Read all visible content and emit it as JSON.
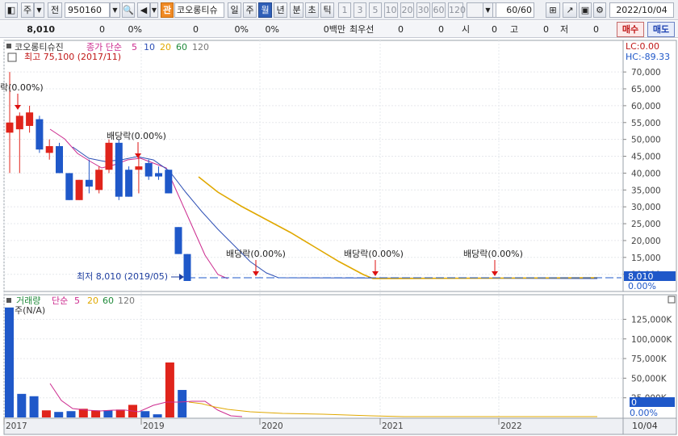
{
  "toolbar": {
    "market_label": "주",
    "prev_label": "전",
    "code": "950160",
    "tag_label": "관",
    "stock_name": "코오롱티슈",
    "period_tabs": [
      "일",
      "주",
      "월",
      "년",
      "분",
      "초",
      "틱"
    ],
    "active_period": "월",
    "interval_buttons": [
      "1",
      "3",
      "5",
      "10",
      "20",
      "30",
      "60",
      "120"
    ],
    "count_value": "60",
    "count_total": "/60",
    "date": "2022/10/04"
  },
  "info_row": {
    "price": "8,010",
    "change": "0",
    "change_pct": "0%",
    "v1": "0",
    "v1_pct": "0%",
    "v2_pct": "0%",
    "amount": "0백만",
    "best_bid_label": "최우선",
    "best_bid_a": "0",
    "best_bid_b": "0",
    "open_label": "시",
    "open_value": "0",
    "high_label": "고",
    "high_value": "0",
    "low_label": "저",
    "low_value": "0",
    "buy_label": "매수",
    "sell_label": "매도"
  },
  "price_panel": {
    "stock_name": "코오롱티슈진",
    "ma_label": "종가 단순",
    "ma_periods": [
      "5",
      "10",
      "20",
      "60",
      "120"
    ],
    "ma_colors": [
      "#cc2a8e",
      "#2d4fb5",
      "#e0a800",
      "#1f8a3a",
      "#777777"
    ],
    "high_note": "최고 75,100 (2017/11)",
    "low_note": "최저 8,010 (2019/05)",
    "lc_label": "LC:0.00",
    "hc_label": "HC:-89.33",
    "current_price_tag": "8,010",
    "current_pct_tag": "0.00%",
    "dividend_labels": [
      "락(0.00%)",
      "배당락(0.00%)",
      "배당락(0.00%)",
      "배당락(0.00%)",
      "배당락(0.00%)"
    ],
    "y_ticks": [
      "70,000",
      "65,000",
      "60,000",
      "55,000",
      "50,000",
      "45,000",
      "40,000",
      "35,000",
      "30,000",
      "25,000",
      "20,000",
      "15,000",
      "10,000"
    ]
  },
  "volume_panel": {
    "label": "거래량",
    "ma_label": "단순",
    "ma_periods": [
      "5",
      "20",
      "60",
      "120"
    ],
    "ma_colors": [
      "#cc2a8e",
      "#e0a800",
      "#1f8a3a",
      "#777777"
    ],
    "unit_label": "주(N/A)",
    "y_ticks": [
      "125,000K",
      "100,000K",
      "75,000K",
      "50,000K",
      "25,000K"
    ],
    "current_tag": "0",
    "pct_tag": "0.00%"
  },
  "x_axis": {
    "labels": [
      "2017",
      "2019",
      "2020",
      "2021",
      "2022"
    ],
    "date_tag": "10/04"
  },
  "colors": {
    "up": "#e0241b",
    "down": "#1f58c9",
    "accent": "#2f5fb8"
  },
  "chart_data": {
    "type": "candlestick",
    "period": "monthly",
    "candles": [
      {
        "open": 52000,
        "high": 70000,
        "low": 40000,
        "close": 55000,
        "dir": "up"
      },
      {
        "open": 53000,
        "high": 58000,
        "low": 40000,
        "close": 57000,
        "dir": "up"
      },
      {
        "open": 54000,
        "high": 60000,
        "low": 52000,
        "close": 58000,
        "dir": "up"
      },
      {
        "open": 56000,
        "high": 57000,
        "low": 46000,
        "close": 47000,
        "dir": "down"
      },
      {
        "open": 46000,
        "high": 50000,
        "low": 44000,
        "close": 48000,
        "dir": "up"
      },
      {
        "open": 48000,
        "high": 49000,
        "low": 40000,
        "close": 40000,
        "dir": "down"
      },
      {
        "open": 40000,
        "high": 40000,
        "low": 32000,
        "close": 32000,
        "dir": "down"
      },
      {
        "open": 32000,
        "high": 38000,
        "low": 32000,
        "close": 38000,
        "dir": "up"
      },
      {
        "open": 38000,
        "high": 44000,
        "low": 34000,
        "close": 36000,
        "dir": "down"
      },
      {
        "open": 35000,
        "high": 42000,
        "low": 34000,
        "close": 41000,
        "dir": "up"
      },
      {
        "open": 41000,
        "high": 50000,
        "low": 40000,
        "close": 49000,
        "dir": "up"
      },
      {
        "open": 49000,
        "high": 50000,
        "low": 32000,
        "close": 33000,
        "dir": "down"
      },
      {
        "open": 33000,
        "high": 42000,
        "low": 33000,
        "close": 41000,
        "dir": "down"
      },
      {
        "open": 41000,
        "high": 45000,
        "low": 34000,
        "close": 42000,
        "dir": "up"
      },
      {
        "open": 43000,
        "high": 44000,
        "low": 38000,
        "close": 39000,
        "dir": "down"
      },
      {
        "open": 39000,
        "high": 42000,
        "low": 38000,
        "close": 40000,
        "dir": "down"
      },
      {
        "open": 41000,
        "high": 41000,
        "low": 34000,
        "close": 34000,
        "dir": "down"
      },
      {
        "open": 24000,
        "high": 24000,
        "low": 16000,
        "close": 16000,
        "dir": "down"
      },
      {
        "open": 16000,
        "high": 16000,
        "low": 8010,
        "close": 8010,
        "dir": "down"
      }
    ],
    "volume": [
      {
        "value": 140000,
        "dir": "down"
      },
      {
        "value": 30000,
        "dir": "down"
      },
      {
        "value": 27000,
        "dir": "down"
      },
      {
        "value": 9000,
        "dir": "up"
      },
      {
        "value": 7000,
        "dir": "down"
      },
      {
        "value": 8000,
        "dir": "down"
      },
      {
        "value": 11000,
        "dir": "up"
      },
      {
        "value": 9000,
        "dir": "up"
      },
      {
        "value": 9000,
        "dir": "down"
      },
      {
        "value": 10000,
        "dir": "up"
      },
      {
        "value": 16000,
        "dir": "up"
      },
      {
        "value": 8000,
        "dir": "down"
      },
      {
        "value": 4000,
        "dir": "down"
      },
      {
        "value": 70000,
        "dir": "up"
      },
      {
        "value": 35000,
        "dir": "down"
      }
    ],
    "price_ylim": [
      8010,
      78000
    ],
    "volume_ylim": [
      0,
      145000
    ]
  }
}
